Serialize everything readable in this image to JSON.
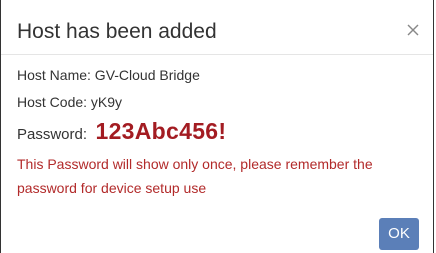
{
  "dialog": {
    "title": "Host has been added",
    "close_icon": "close-icon"
  },
  "body": {
    "host_name": "Host Name: GV-Cloud Bridge",
    "host_code": "Host Code: yK9y",
    "password_label": "Password:",
    "password_value": "123Abc456!",
    "warning": "This Password will show only once, please remember the password for device setup use"
  },
  "footer": {
    "ok_label": "OK"
  },
  "colors": {
    "password": "#a31c22",
    "warning": "#b22a2a",
    "ok_button": "#5b7fb8"
  }
}
